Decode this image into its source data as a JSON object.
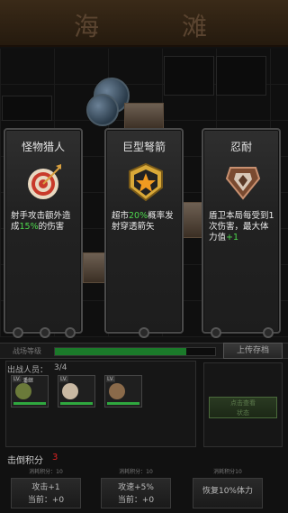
{
  "title": {
    "left_char": "海",
    "right_char": "滩"
  },
  "cards": [
    {
      "title": "怪物猎人",
      "icon": "target-icon",
      "desc_before": "射手攻击额外造成",
      "desc_highlight": "15%",
      "desc_after": "的伤害"
    },
    {
      "title": "巨型弩箭",
      "icon": "star-shield-icon",
      "desc_before": "超市",
      "desc_highlight": "20%",
      "desc_after": "概率发射穿透箭矢"
    },
    {
      "title": "忍耐",
      "icon": "shield-icon",
      "desc_before": "盾卫本局每受到1次伤害，最大体力值",
      "desc_highlight": "+1",
      "desc_after": ""
    }
  ],
  "status": {
    "label": "战场等级",
    "progress": 0.82
  },
  "upload_button": "上传存档",
  "team": {
    "label": "出战人员：",
    "count": "3/4",
    "members": [
      {
        "level": "LV.",
        "name": "潘继",
        "face": "#6b7a3a"
      },
      {
        "level": "LV.",
        "name": "",
        "face": "#c9b9a3"
      },
      {
        "level": "LV.",
        "name": "",
        "face": "#8a6a4a"
      }
    ]
  },
  "side_button": "点击查看\n状态",
  "score": {
    "label": "击倒积分",
    "value": "3"
  },
  "upgrades": [
    {
      "cost": "消耗积分：10",
      "label": "攻击+1",
      "sub": "当前：+0"
    },
    {
      "cost": "消耗积分：10",
      "label": "攻速+5%",
      "sub": "当前：+0"
    },
    {
      "cost": "消耗积分10",
      "label": "恢复10%体力",
      "sub": ""
    }
  ],
  "colors": {
    "accent_green": "#4ed84e",
    "score_red": "#dd2222"
  }
}
